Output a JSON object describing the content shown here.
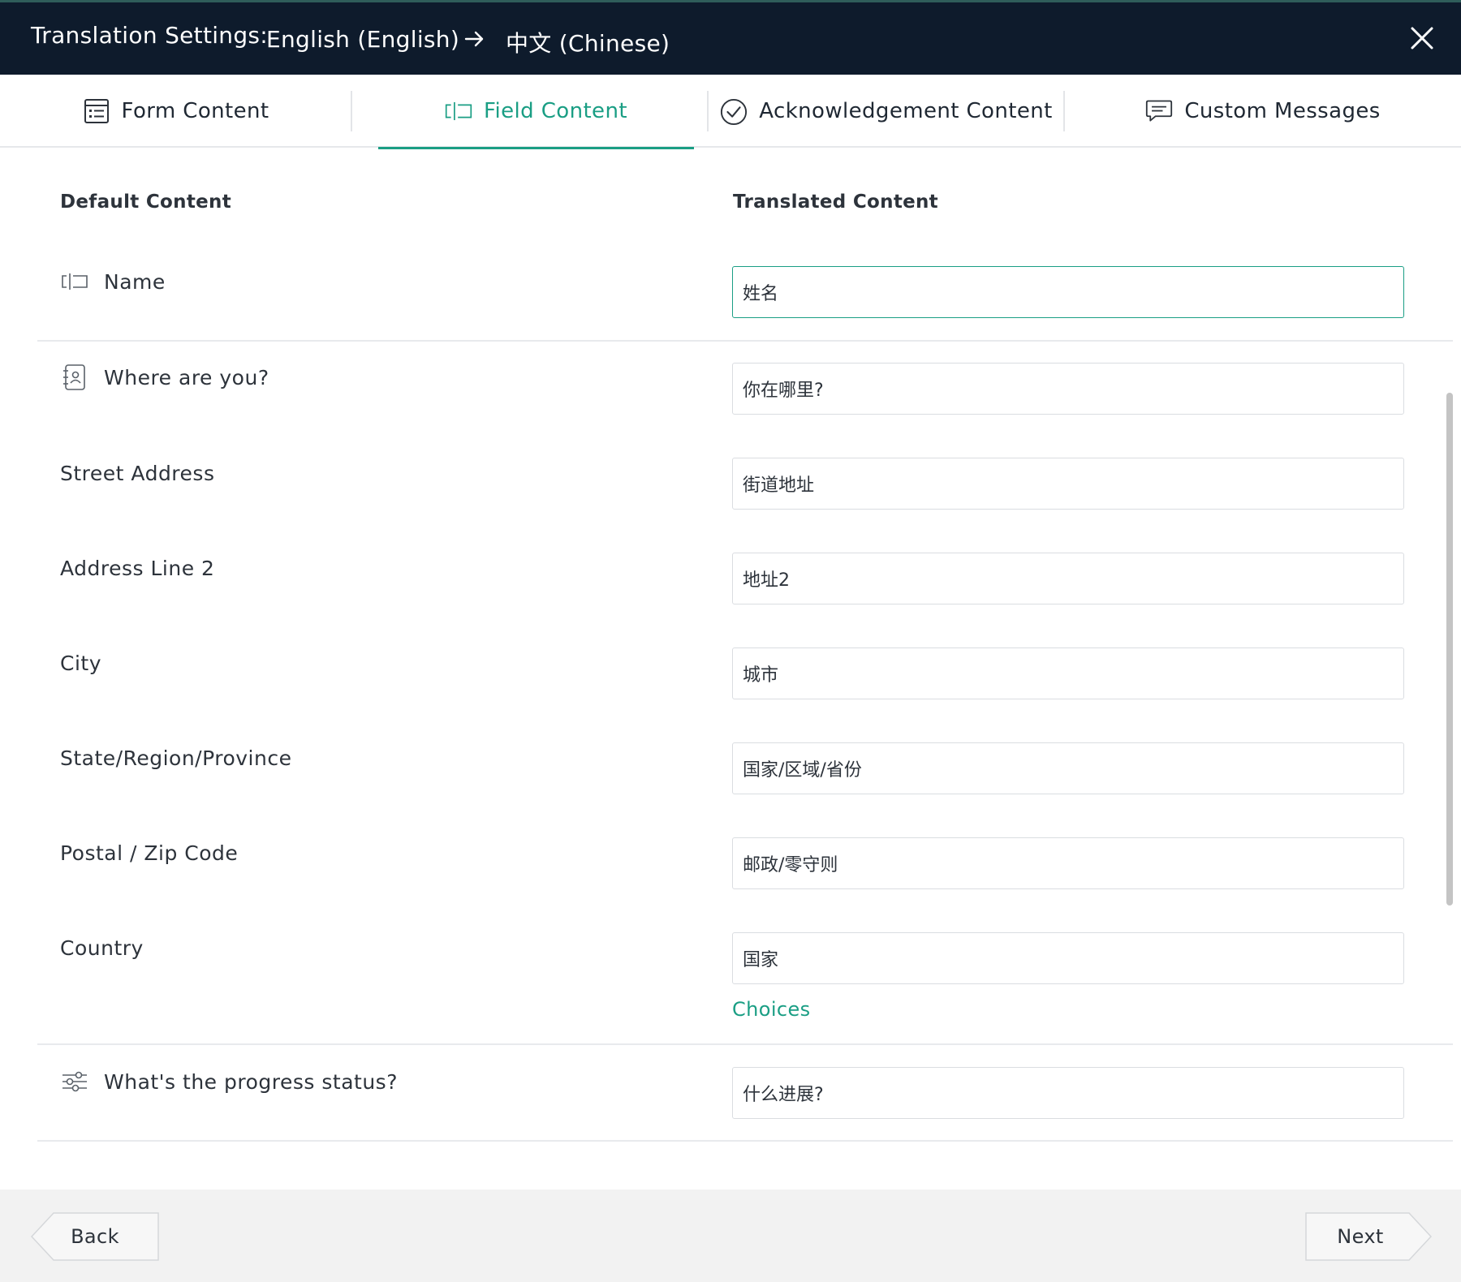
{
  "header": {
    "title": "Translation Settings:",
    "source_language": "English (English)",
    "arrow_icon": "arrow-right-icon",
    "target_language": "中文 (Chinese)",
    "close_icon": "close-icon"
  },
  "tabs": [
    {
      "label": "Form Content",
      "icon": "form-list-icon",
      "active": false
    },
    {
      "label": "Field Content",
      "icon": "field-input-icon",
      "active": true
    },
    {
      "label": "Acknowledgement Content",
      "icon": "check-circle-icon",
      "active": false
    },
    {
      "label": "Custom Messages",
      "icon": "message-bubble-icon",
      "active": false
    }
  ],
  "columns": {
    "default": "Default Content",
    "translated": "Translated Content"
  },
  "rows": [
    {
      "label": "Name",
      "icon": "field-input-icon",
      "value": "姓名"
    },
    {
      "label": "Where are you?",
      "icon": "address-book-icon",
      "value": "你在哪里?"
    },
    {
      "label": "Street Address",
      "value": "街道地址"
    },
    {
      "label": "Address Line 2",
      "value": "地址2"
    },
    {
      "label": "City",
      "value": "城市"
    },
    {
      "label": "State/Region/Province",
      "value": "国家/区域/省份"
    },
    {
      "label": "Postal / Zip Code",
      "value": "邮政/零守则"
    },
    {
      "label": "Country",
      "value": "国家"
    },
    {
      "label": "What's the progress status?",
      "icon": "sliders-icon",
      "value": "什么进展?"
    }
  ],
  "choices_link": "Choices",
  "footer": {
    "back": "Back",
    "next": "Next"
  },
  "colors": {
    "header_bg": "#0e1b2c",
    "accent": "#1a9e84",
    "footer_bg": "#f2f2f2"
  }
}
